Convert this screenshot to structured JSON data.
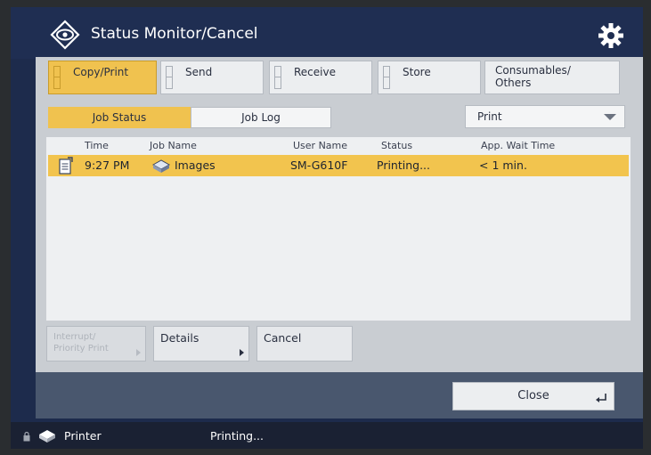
{
  "header": {
    "title": "Status Monitor/Cancel",
    "logo_icon": "status-monitor-eye-icon",
    "settings_icon": "gear-icon"
  },
  "tabs": [
    {
      "label": "Copy/Print",
      "active": true
    },
    {
      "label": "Send",
      "active": false
    },
    {
      "label": "Receive",
      "active": false
    },
    {
      "label": "Store",
      "active": false
    },
    {
      "label_line1": "Consumables/",
      "label_line2": "Others",
      "active": false
    }
  ],
  "subtabs": {
    "job_status": "Job Status",
    "job_log": "Job Log"
  },
  "filter": {
    "selected": "Print"
  },
  "table": {
    "headers": {
      "time": "Time",
      "job_name": "Job Name",
      "user_name": "User Name",
      "status": "Status",
      "wait": "App. Wait Time"
    },
    "rows": [
      {
        "time": "9:27 PM",
        "job_name": "Images",
        "user_name": "SM-G610F",
        "status": "Printing...",
        "wait": "< 1 min.",
        "selected": true
      }
    ]
  },
  "actions": {
    "interrupt_line1": "Interrupt/",
    "interrupt_line2": "Priority Print",
    "details": "Details",
    "cancel": "Cancel"
  },
  "footer": {
    "close": "Close"
  },
  "statusbar": {
    "device": "Printer",
    "status": "Printing..."
  },
  "colors": {
    "accent": "#f0c24f",
    "header_bg": "#1f2e52",
    "panel_bg": "#c9cdd2"
  }
}
